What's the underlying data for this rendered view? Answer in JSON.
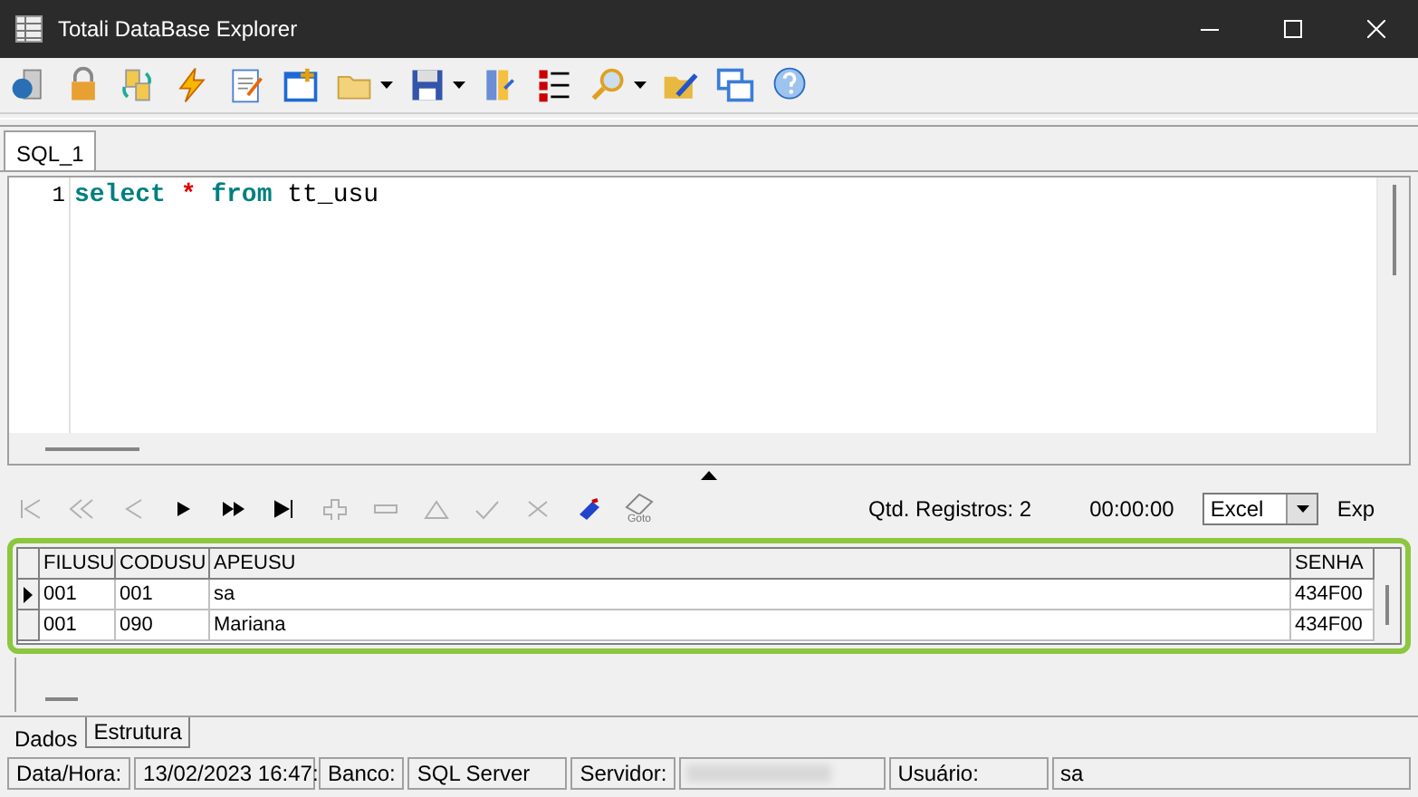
{
  "window": {
    "title": "Totali DataBase Explorer"
  },
  "sql_tabs": [
    {
      "label": "SQL_1",
      "selected": true
    }
  ],
  "editor": {
    "lines": [
      {
        "number": "1",
        "tokens": [
          {
            "text": "select",
            "kind": "keyword"
          },
          {
            "text": "*",
            "kind": "operator"
          },
          {
            "text": "from",
            "kind": "keyword"
          },
          {
            "text": "tt_usu",
            "kind": "identifier"
          }
        ]
      }
    ]
  },
  "navigator": {
    "record_count": "Qtd. Registros: 2",
    "elapsed": "00:00:00",
    "export_format": "Excel",
    "export_label": "Exp",
    "goto_label": "Goto"
  },
  "grid": {
    "columns": [
      "FILUSU",
      "CODUSU",
      "APEUSU",
      "SENHA"
    ],
    "rows": [
      {
        "selected": true,
        "cells": [
          "001",
          "001",
          "sa",
          "434F00"
        ]
      },
      {
        "selected": false,
        "cells": [
          "001",
          "090",
          "Mariana",
          "434F00"
        ]
      }
    ]
  },
  "bottom_tabs": [
    {
      "label": "Dados",
      "selected": true
    },
    {
      "label": "Estrutura",
      "selected": false
    }
  ],
  "status_bar": [
    {
      "kind": "label",
      "text": "Data/Hora:"
    },
    {
      "kind": "value",
      "text": "13/02/2023 16:47:"
    },
    {
      "kind": "label",
      "text": "Banco:"
    },
    {
      "kind": "value",
      "text": "SQL Server"
    },
    {
      "kind": "label",
      "text": "Servidor:"
    },
    {
      "kind": "blurred"
    },
    {
      "kind": "label",
      "text": "Usuário:"
    },
    {
      "kind": "value",
      "text": "sa"
    }
  ]
}
